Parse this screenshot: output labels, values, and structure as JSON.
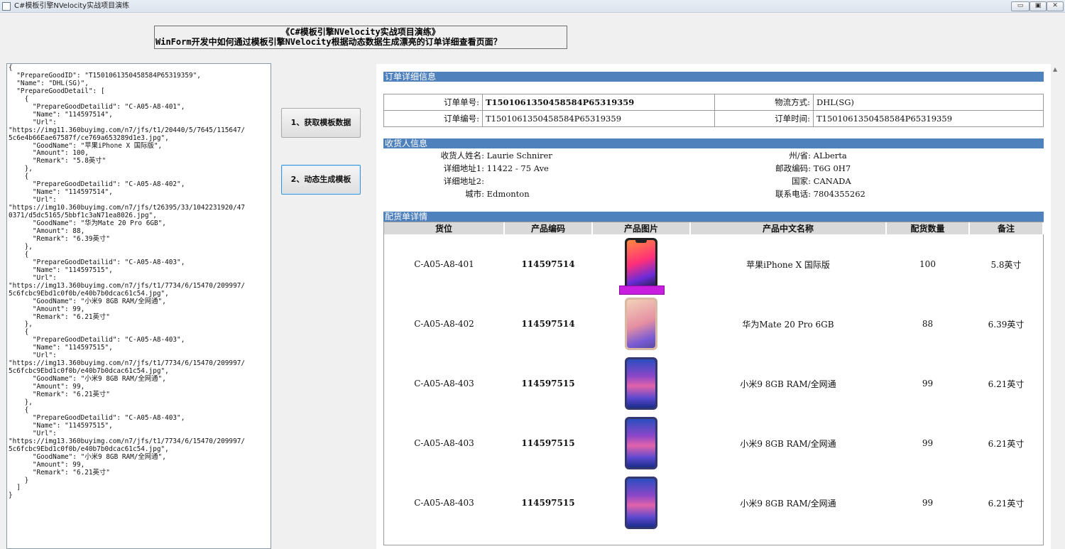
{
  "window": {
    "title": "C#模板引擎NVelocity实战项目演练",
    "controls": {
      "minimize": "▭",
      "restore": "▣",
      "close": "✕"
    }
  },
  "heading": {
    "line1": "《C#模板引擎NVelocity实战项目演练》",
    "line2": "WinForm开发中如何通过模板引擎NVelocity根据动态数据生成漂亮的订单详细查看页面？"
  },
  "json_text": "{\n  \"PrepareGoodID\": \"T1501061350458584P65319359\",\n  \"Name\": \"DHL(SG)\",\n  \"PrepareGoodDetail\": [\n    {\n      \"PrepareGoodDetailid\": \"C-A05-A8-401\",\n      \"Name\": \"114597514\",\n      \"Url\":\n\"https://img11.360buyimg.com/n7/jfs/t1/20440/5/7645/115647/\n5c6e4b66Eae67587f/ce769a653289d1e3.jpg\",\n      \"GoodName\": \"苹果iPhone X 国际版\",\n      \"Amount\": 100,\n      \"Remark\": \"5.8英寸\"\n    },\n    {\n      \"PrepareGoodDetailid\": \"C-A05-A8-402\",\n      \"Name\": \"114597514\",\n      \"Url\":\n\"https://img10.360buyimg.com/n7/jfs/t26395/33/1042231920/47\n0371/d5dc5165/5bbf1c3aN71ea8026.jpg\",\n      \"GoodName\": \"华为Mate 20 Pro 6GB\",\n      \"Amount\": 88,\n      \"Remark\": \"6.39英寸\"\n    },\n    {\n      \"PrepareGoodDetailid\": \"C-A05-A8-403\",\n      \"Name\": \"114597515\",\n      \"Url\":\n\"https://img13.360buyimg.com/n7/jfs/t1/7734/6/15470/209997/\n5c6fcbc9Ebd1c0f0b/e40b7b0dcac61c54.jpg\",\n      \"GoodName\": \"小米9 8GB RAM/全网通\",\n      \"Amount\": 99,\n      \"Remark\": \"6.21英寸\"\n    },\n    {\n      \"PrepareGoodDetailid\": \"C-A05-A8-403\",\n      \"Name\": \"114597515\",\n      \"Url\":\n\"https://img13.360buyimg.com/n7/jfs/t1/7734/6/15470/209997/\n5c6fcbc9Ebd1c0f0b/e40b7b0dcac61c54.jpg\",\n      \"GoodName\": \"小米9 8GB RAM/全网通\",\n      \"Amount\": 99,\n      \"Remark\": \"6.21英寸\"\n    },\n    {\n      \"PrepareGoodDetailid\": \"C-A05-A8-403\",\n      \"Name\": \"114597515\",\n      \"Url\":\n\"https://img13.360buyimg.com/n7/jfs/t1/7734/6/15470/209997/\n5c6fcbc9Ebd1c0f0b/e40b7b0dcac61c54.jpg\",\n      \"GoodName\": \"小米9 8GB RAM/全网通\",\n      \"Amount\": 99,\n      \"Remark\": \"6.21英寸\"\n    }\n  ]\n}",
  "buttons": {
    "fetch": "1、获取模板数据",
    "generate": "2、动态生成模板"
  },
  "order_section": {
    "title": "订单详细信息",
    "order_no_label": "订单单号:",
    "order_no_value": "T1501061350458584P65319359",
    "logistics_label": "物流方式:",
    "logistics_value": "DHL(SG)",
    "order_code_label": "订单编号:",
    "order_code_value": "T1501061350458584P65319359",
    "order_time_label": "订单时间:",
    "order_time_value": "T1501061350458584P65319359"
  },
  "receiver_section": {
    "title": "收货人信息",
    "name_label": "收货人姓名:",
    "name_value": "Laurie Schnirer",
    "addr1_label": "详细地址1:",
    "addr1_value": "11422 - 75 Ave",
    "addr2_label": "详细地址2:",
    "addr2_value": "",
    "city_label": "城市:",
    "city_value": "Edmonton",
    "state_label": "州/省:",
    "state_value": "ALberta",
    "postcode_label": "邮政编码:",
    "postcode_value": "T6G 0H7",
    "country_label": "国家:",
    "country_value": "CANADA",
    "phone_label": "联系电话:",
    "phone_value": "7804355262"
  },
  "goods_section": {
    "title": "配货单详情",
    "columns": [
      "货位",
      "产品编码",
      "产品图片",
      "产品中文名称",
      "配货数量",
      "备注"
    ],
    "rows": [
      {
        "location": "C-A05-A8-401",
        "code": "114597514",
        "image": "iphone-x-image",
        "name": "苹果iPhone X 国际版",
        "qty": "100",
        "remark": "5.8英寸"
      },
      {
        "location": "C-A05-A8-402",
        "code": "114597514",
        "image": "huawei-mate20-image",
        "name": "华为Mate 20 Pro 6GB",
        "qty": "88",
        "remark": "6.39英寸"
      },
      {
        "location": "C-A05-A8-403",
        "code": "114597515",
        "image": "xiaomi-9-image",
        "name": "小米9 8GB RAM/全网通",
        "qty": "99",
        "remark": "6.21英寸"
      },
      {
        "location": "C-A05-A8-403",
        "code": "114597515",
        "image": "xiaomi-9-image",
        "name": "小米9 8GB RAM/全网通",
        "qty": "99",
        "remark": "6.21英寸"
      },
      {
        "location": "C-A05-A8-403",
        "code": "114597515",
        "image": "xiaomi-9-image",
        "name": "小米9 8GB RAM/全网通",
        "qty": "99",
        "remark": "6.21英寸"
      }
    ]
  },
  "colors": {
    "section_bar": "#4f81bd",
    "header_bg": "#d9d9d9",
    "focus_border": "#3c97d8"
  }
}
